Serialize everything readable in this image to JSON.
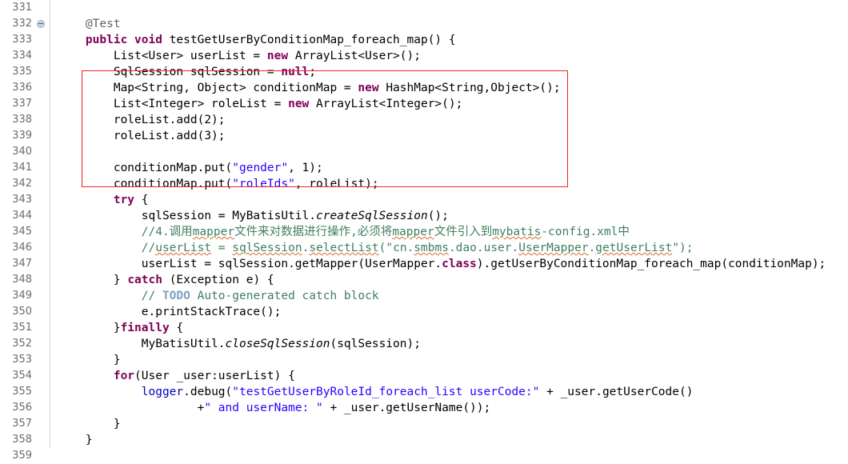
{
  "editor": {
    "first_visible_line": 331,
    "last_visible_line": 359,
    "fold_marker_line": 332,
    "fold_marker_icon": "collapse-minus-icon",
    "highlight_box_color": "#ee2222",
    "highlight_box_lines": "336-342",
    "colors": {
      "keyword": "#7f0055",
      "string": "#2a00ff",
      "comment": "#3f7f5f",
      "todo": "#7f9fbf",
      "annotation": "#646464",
      "field": "#0000c0",
      "plain": "#000000",
      "spellcheck_underline": "#d86a2a",
      "gutter_text": "#6b6b6b",
      "background": "#ffffff"
    }
  },
  "gutter": {
    "numbers": [
      "331",
      "332",
      "333",
      "334",
      "335",
      "336",
      "337",
      "338",
      "339",
      "340",
      "341",
      "342",
      "343",
      "344",
      "345",
      "346",
      "347",
      "348",
      "349",
      "350",
      "351",
      "352",
      "353",
      "354",
      "355",
      "356",
      "357",
      "358",
      "359"
    ]
  },
  "code": {
    "lines": [
      {
        "n": "331",
        "text": ""
      },
      {
        "n": "332",
        "text": "    @Test"
      },
      {
        "n": "333",
        "text": "    public void testGetUserByConditionMap_foreach_map() {"
      },
      {
        "n": "334",
        "text": "        List<User> userList = new ArrayList<User>();"
      },
      {
        "n": "335",
        "text": "        SqlSession sqlSession = null;"
      },
      {
        "n": "336",
        "text": "        Map<String, Object> conditionMap = new HashMap<String,Object>();"
      },
      {
        "n": "337",
        "text": "        List<Integer> roleList = new ArrayList<Integer>();"
      },
      {
        "n": "338",
        "text": "        roleList.add(2);"
      },
      {
        "n": "339",
        "text": "        roleList.add(3);"
      },
      {
        "n": "340",
        "text": ""
      },
      {
        "n": "341",
        "text": "        conditionMap.put(\"gender\", 1);"
      },
      {
        "n": "342",
        "text": "        conditionMap.put(\"roleIds\", roleList);"
      },
      {
        "n": "343",
        "text": "        try {"
      },
      {
        "n": "344",
        "text": "            sqlSession = MyBatisUtil.createSqlSession();"
      },
      {
        "n": "345",
        "text": "            //4.调用mapper文件来对数据进行操作,必须将mapper文件引入到mybatis-config.xml中"
      },
      {
        "n": "346",
        "text": "            //userList = sqlSession.selectList(\"cn.smbms.dao.user.UserMapper.getUserList\");"
      },
      {
        "n": "347",
        "text": "            userList = sqlSession.getMapper(UserMapper.class).getUserByConditionMap_foreach_map(conditionMap);"
      },
      {
        "n": "348",
        "text": "        } catch (Exception e) {"
      },
      {
        "n": "349",
        "text": "            // TODO Auto-generated catch block"
      },
      {
        "n": "350",
        "text": "            e.printStackTrace();"
      },
      {
        "n": "351",
        "text": "        }finally {"
      },
      {
        "n": "352",
        "text": "            MyBatisUtil.closeSqlSession(sqlSession);"
      },
      {
        "n": "353",
        "text": "        }"
      },
      {
        "n": "354",
        "text": "        for(User _user:userList) {"
      },
      {
        "n": "355",
        "text": "            logger.debug(\"testGetUserByRoleId_foreach_list userCode:\" + _user.getUserCode()"
      },
      {
        "n": "356",
        "text": "                    +\" and userName: \" + _user.getUserName());"
      },
      {
        "n": "357",
        "text": "        }"
      },
      {
        "n": "358",
        "text": "    }"
      },
      {
        "n": "359",
        "text": ""
      }
    ]
  }
}
